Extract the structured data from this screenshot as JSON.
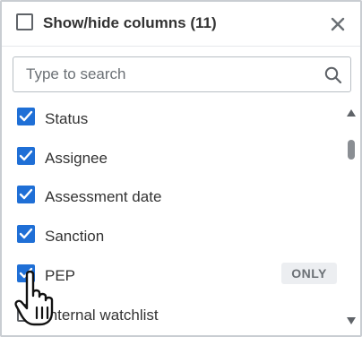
{
  "panel": {
    "title": "Show/hide columns (11)",
    "close_icon": "close-icon"
  },
  "search": {
    "placeholder": "Type to search",
    "value": "",
    "icon": "search-icon"
  },
  "columns": [
    {
      "label": "Status",
      "checked": true
    },
    {
      "label": "Assignee",
      "checked": true
    },
    {
      "label": "Assessment date",
      "checked": true
    },
    {
      "label": "Sanction",
      "checked": true
    },
    {
      "label": "PEP",
      "checked": true,
      "badge": "ONLY"
    },
    {
      "label": "Internal watchlist",
      "checked": false
    }
  ],
  "colors": {
    "checkbox_checked": "#1f6fd6",
    "text": "#333333",
    "badge_bg": "#eceef1",
    "border": "#c9cdd2"
  }
}
